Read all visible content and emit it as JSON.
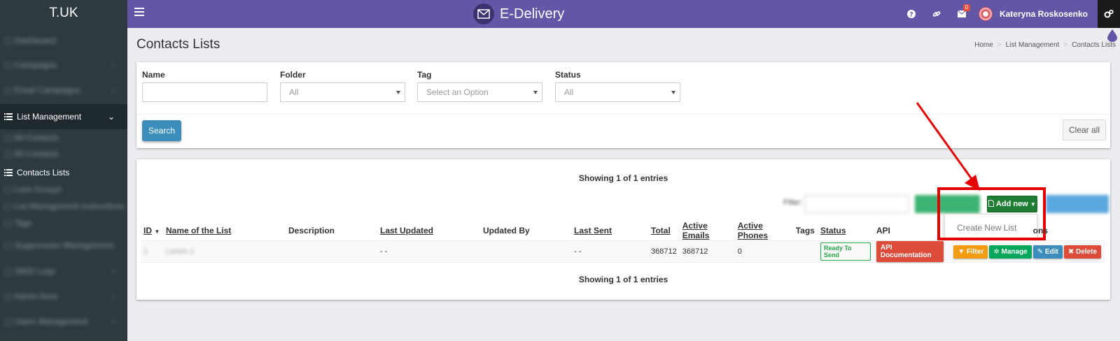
{
  "brand": "T.UK",
  "app_title": "E-Delivery",
  "header": {
    "notifications_count": "0",
    "user_name": "Kateryna Roskosenko"
  },
  "sidebar": {
    "active_section": "List Management",
    "active_item": "Contacts Lists"
  },
  "page": {
    "title": "Contacts Lists",
    "breadcrumb": [
      "Home",
      "List Management",
      "Contacts Lists"
    ]
  },
  "filters": {
    "name_label": "Name",
    "name_value": "",
    "folder_label": "Folder",
    "folder_value": "All",
    "tag_label": "Tag",
    "tag_placeholder": "Select an Option",
    "status_label": "Status",
    "status_value": "All",
    "search_label": "Search",
    "clear_label": "Clear all"
  },
  "table": {
    "showing_top": "Showing 1 of 1 entries",
    "showing_bottom": "Showing 1 of 1 entries",
    "add_new_label": "Add new",
    "dropdown_item": "Create New List",
    "columns": {
      "id": "ID",
      "name": "Name of the List",
      "description": "Description",
      "last_updated": "Last Updated",
      "updated_by": "Updated By",
      "last_sent": "Last Sent",
      "total": "Total",
      "active_emails": "Active Emails",
      "active_phones": "Active Phones",
      "tags": "Tags",
      "status": "Status",
      "api": "API",
      "actions_tail": "ons"
    },
    "rows": [
      {
        "last_updated": "- -",
        "last_sent": "- -",
        "total": "368712",
        "active_emails": "368712",
        "active_phones": "0",
        "status": "Ready To Send",
        "api_label": "API Documentation",
        "filter_label": "Filter",
        "manage_label": "Manage",
        "edit_label": "Edit",
        "delete_label": "Delete"
      }
    ]
  },
  "colors": {
    "topbar": "#6256a6",
    "sidebar": "#2d3a40",
    "annotation": "#e50000"
  }
}
